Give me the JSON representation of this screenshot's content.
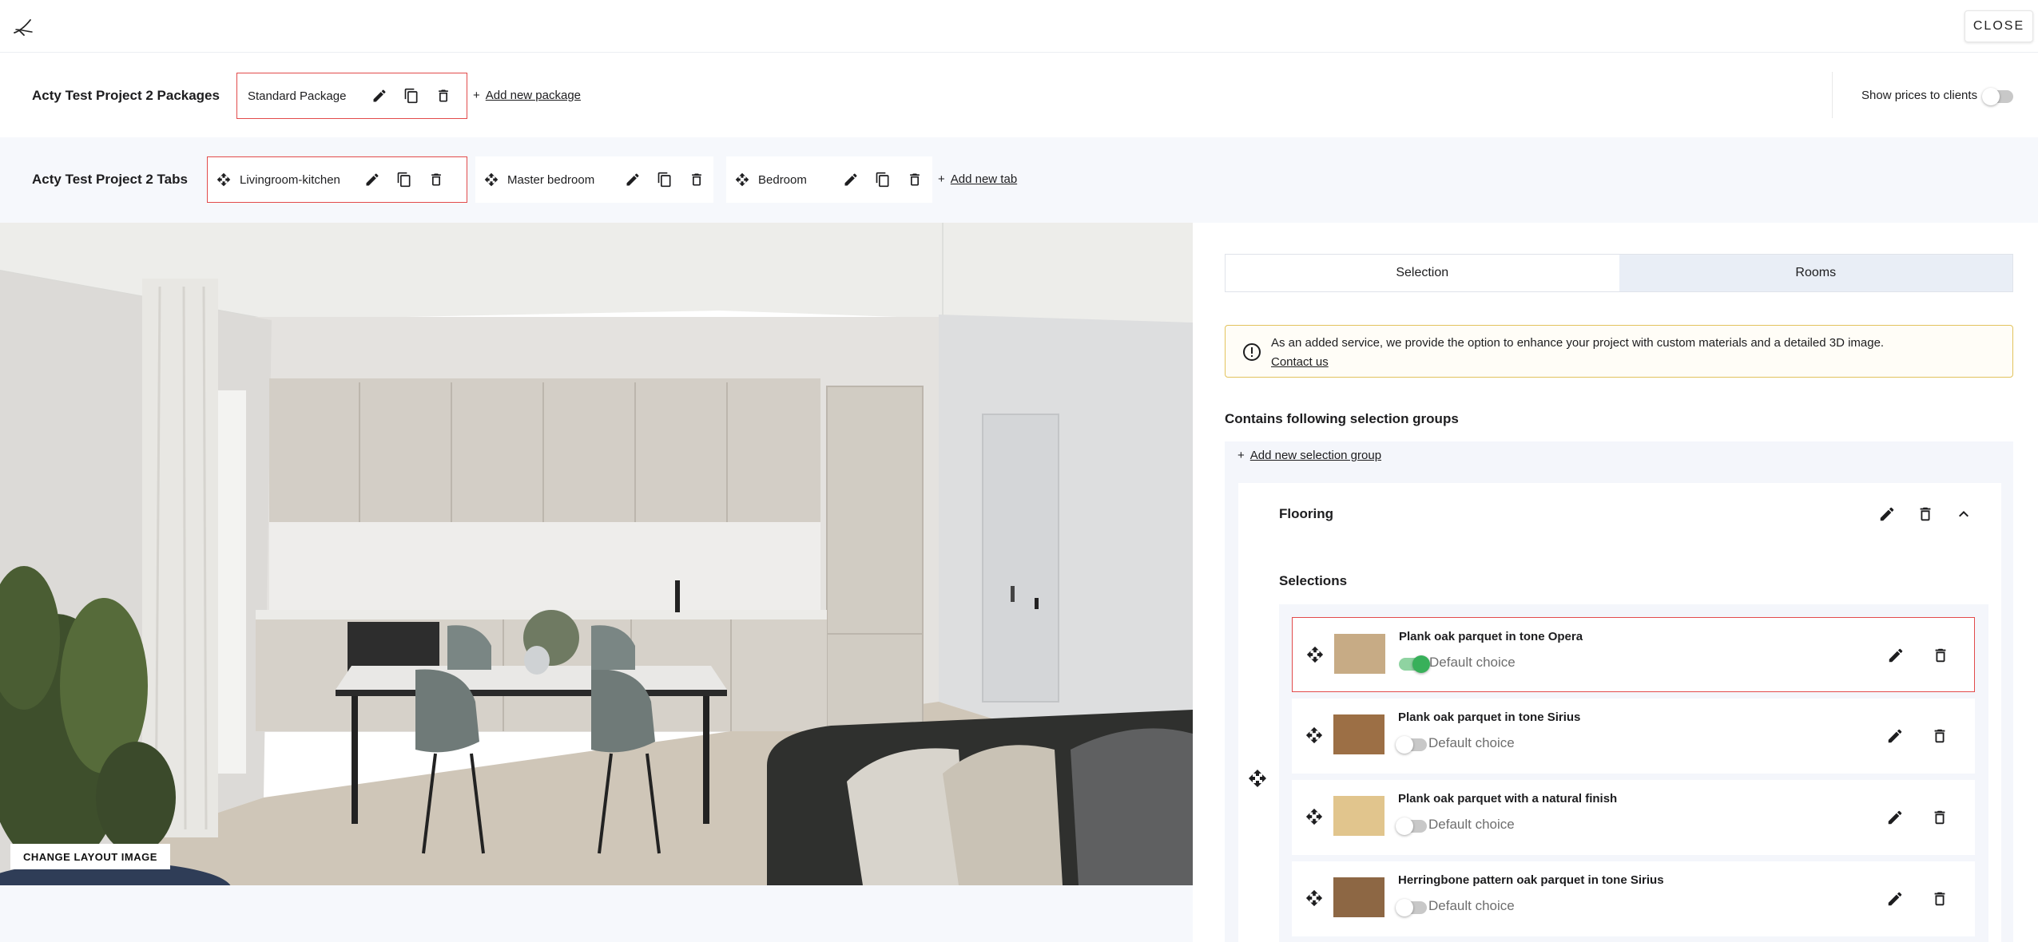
{
  "header": {
    "close_label": "CLOSE"
  },
  "packages": {
    "title": "Acty Test Project 2 Packages",
    "items": [
      {
        "label": "Standard Package"
      }
    ],
    "add_label": "Add new package",
    "show_prices_label": "Show prices to clients",
    "show_prices_on": false
  },
  "tabs": {
    "title": "Acty Test Project 2 Tabs",
    "items": [
      {
        "label": "Livingroom-kitchen",
        "selected": true
      },
      {
        "label": "Master bedroom",
        "selected": false
      },
      {
        "label": "Bedroom",
        "selected": false
      }
    ],
    "add_label": "Add new tab"
  },
  "layout_image": {
    "change_label": "CHANGE LAYOUT IMAGE"
  },
  "panel": {
    "segments": [
      {
        "label": "Selection",
        "active": true
      },
      {
        "label": "Rooms",
        "active": false
      }
    ],
    "info": {
      "text": "As an added service, we provide the option to enhance your project with custom materials and a detailed 3D image.",
      "link": "Contact us",
      "border_color": "#e2c35d"
    },
    "groups_heading": "Contains following selection groups",
    "add_group_label": "Add new selection group",
    "group": {
      "title": "Flooring",
      "selections_heading": "Selections",
      "items": [
        {
          "name": "Plank oak parquet in tone Opera",
          "default_label": "Default choice",
          "is_default": true,
          "selected": true,
          "swatch": "#c7ab85"
        },
        {
          "name": "Plank oak parquet in tone Sirius",
          "default_label": "Default choice",
          "is_default": false,
          "selected": false,
          "swatch": "#9c6f45"
        },
        {
          "name": "Plank oak parquet with a natural finish",
          "default_label": "Default choice",
          "is_default": false,
          "selected": false,
          "swatch": "#e1c58d"
        },
        {
          "name": "Herringbone pattern oak parquet in tone Sirius",
          "default_label": "Default choice",
          "is_default": false,
          "selected": false,
          "swatch": "#8d6744"
        }
      ]
    }
  },
  "colors": {
    "selection_border": "#e24b4b",
    "toggle_on": "#38b05a",
    "panel_bg": "#f4f6fb"
  }
}
